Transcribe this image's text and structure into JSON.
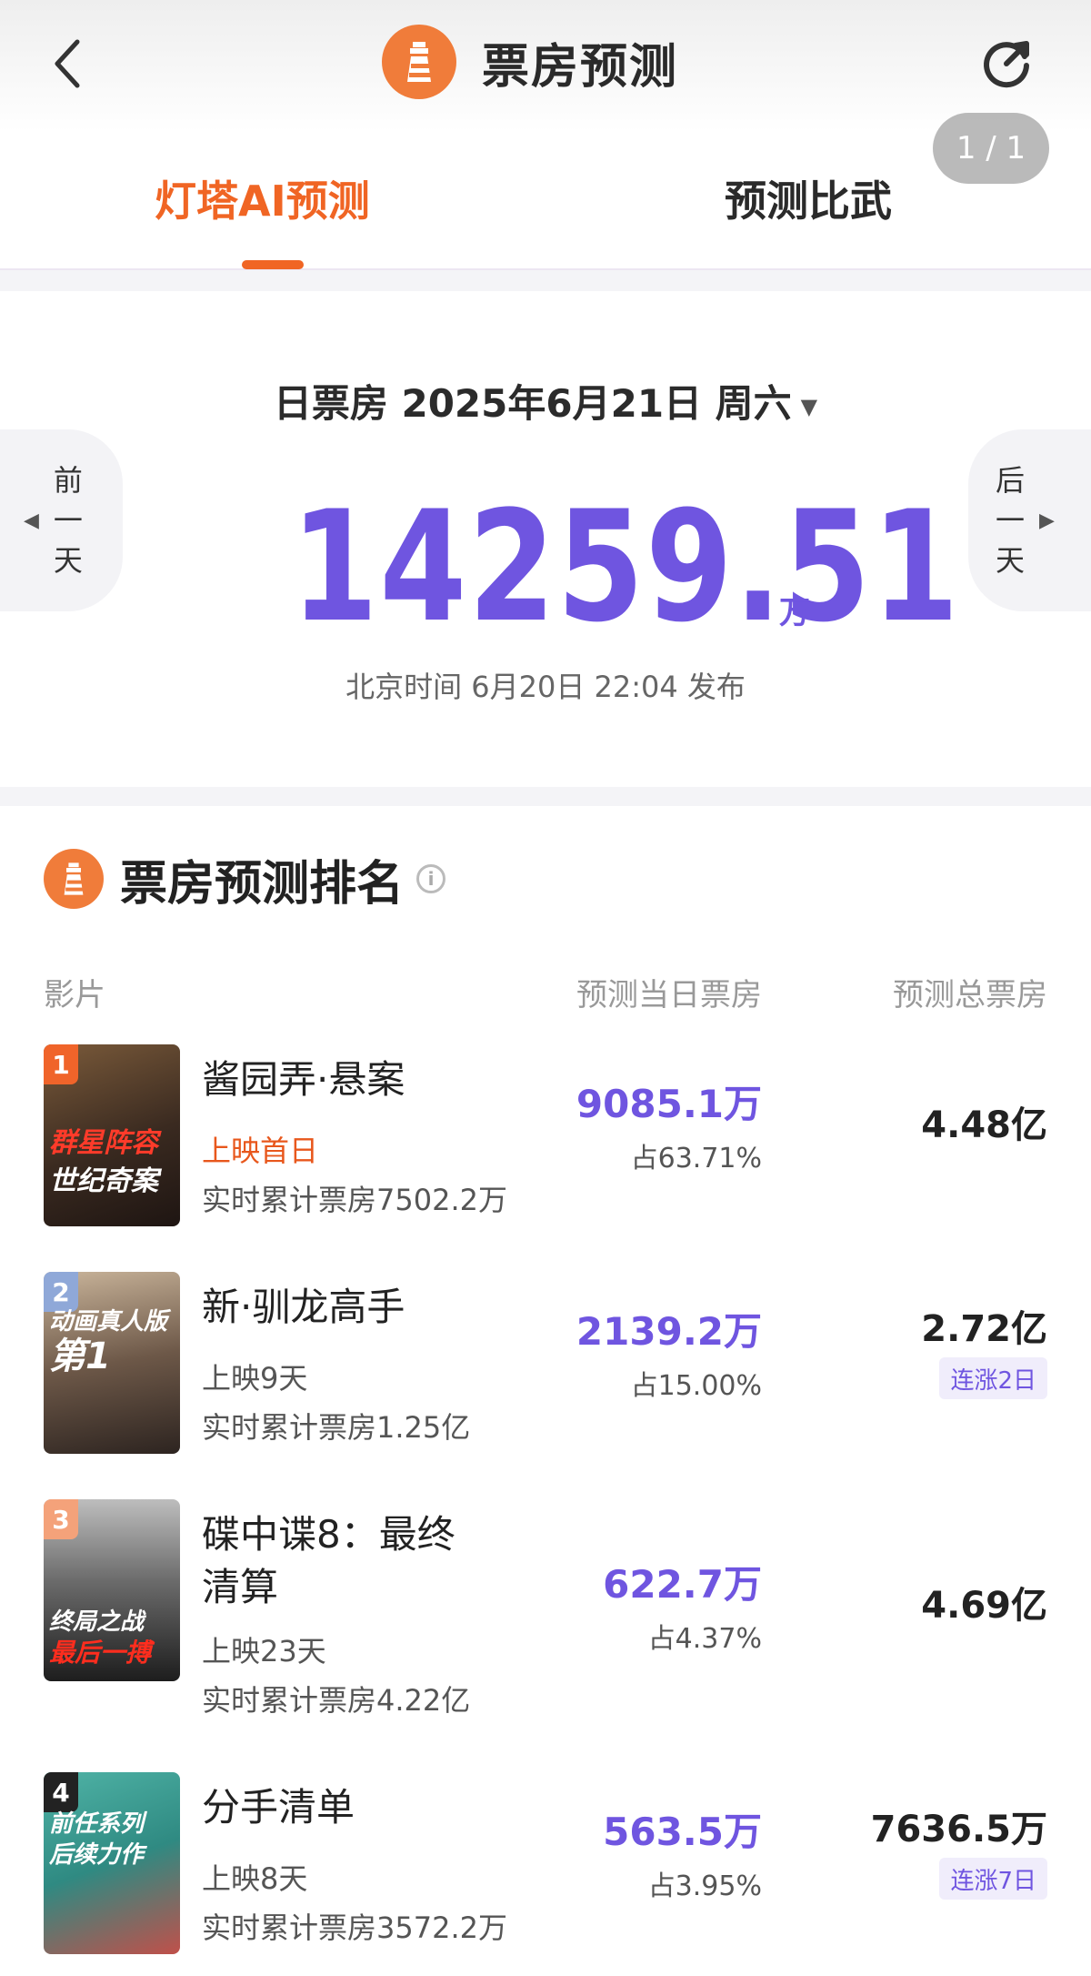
{
  "header": {
    "title": "票房预测",
    "page_indicator": "1 / 1",
    "icons": [
      "back-arrow-icon",
      "lighthouse-logo-icon",
      "refresh-icon"
    ]
  },
  "tabs": [
    {
      "label": "灯塔AI预测",
      "active": true
    },
    {
      "label": "预测比武",
      "active": false
    }
  ],
  "summary": {
    "date_label": "日票房 2025年6月21日 周六",
    "prev_day": [
      "前",
      "一",
      "天"
    ],
    "next_day": [
      "后",
      "一",
      "天"
    ],
    "total_value": "14259.51",
    "total_unit": "万",
    "publish_time": "北京时间 6月20日 22:04 发布"
  },
  "ranking": {
    "title": "票房预测排名",
    "columns": {
      "film": "影片",
      "day_forecast": "预测当日票房",
      "total_forecast": "预测总票房"
    },
    "films": [
      {
        "rank": "1",
        "name": "酱园弄·悬案",
        "status": "上映首日",
        "cumulative": "实时累计票房7502.2万",
        "day_value": "9085.1万",
        "day_share": "占63.71%",
        "total_value": "4.48亿",
        "streak": "",
        "poster_text_1": "群星阵容",
        "poster_text_2": "世纪奇案",
        "badge_color": "#f0642a"
      },
      {
        "rank": "2",
        "name": "新·驯龙高手",
        "status": "上映9天",
        "cumulative": "实时累计票房1.25亿",
        "day_value": "2139.2万",
        "day_share": "占15.00%",
        "total_value": "2.72亿",
        "streak": "连涨2日",
        "poster_text_1": "动画真人版",
        "poster_text_2": "第1",
        "badge_color": "#8fa8d8"
      },
      {
        "rank": "3",
        "name": "碟中谍8：最终清算",
        "status": "上映23天",
        "cumulative": "实时累计票房4.22亿",
        "day_value": "622.7万",
        "day_share": "占4.37%",
        "total_value": "4.69亿",
        "streak": "",
        "poster_text_1": "终局之战",
        "poster_text_2": "最后一搏",
        "badge_color": "#f4a27a"
      },
      {
        "rank": "4",
        "name": "分手清单",
        "status": "上映8天",
        "cumulative": "实时累计票房3572.2万",
        "day_value": "563.5万",
        "day_share": "占3.95%",
        "total_value": "7636.5万",
        "streak": "连涨7日",
        "poster_text_1": "前任系列",
        "poster_text_2": "后续力作",
        "badge_color": "#222222"
      }
    ]
  },
  "colors": {
    "accent_orange": "#f06524",
    "accent_purple": "#6f55e0",
    "logo_orange": "#f07c3a"
  }
}
